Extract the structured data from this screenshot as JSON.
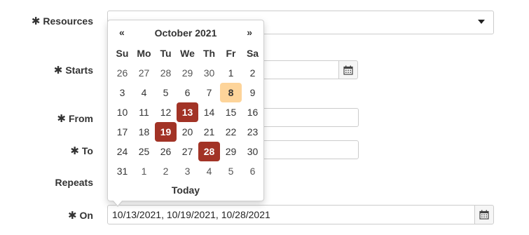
{
  "form": {
    "required_marker": "✱",
    "resources_label": "Resources",
    "starts_label": "Starts",
    "from_label": "From",
    "to_label": "To",
    "repeats_label": "Repeats",
    "on_label": "On",
    "on_value": "10/13/2021, 10/19/2021, 10/28/2021"
  },
  "datepicker": {
    "prev": "«",
    "next": "»",
    "month_title": "October 2021",
    "weekdays": [
      "Su",
      "Mo",
      "Tu",
      "We",
      "Th",
      "Fr",
      "Sa"
    ],
    "weeks": [
      [
        "26",
        "27",
        "28",
        "29",
        "30",
        "1",
        "2"
      ],
      [
        "3",
        "4",
        "5",
        "6",
        "7",
        "8",
        "9"
      ],
      [
        "10",
        "11",
        "12",
        "13",
        "14",
        "15",
        "16"
      ],
      [
        "17",
        "18",
        "19",
        "20",
        "21",
        "22",
        "23"
      ],
      [
        "24",
        "25",
        "26",
        "27",
        "28",
        "29",
        "30"
      ],
      [
        "31",
        "1",
        "2",
        "3",
        "4",
        "5",
        "6"
      ]
    ],
    "today_day": "8",
    "selected_days": [
      "13",
      "19",
      "28"
    ],
    "today_button": "Today"
  },
  "colors": {
    "selected": "#a23326",
    "today": "#fdd49a",
    "repeats_accent": "#f5a623"
  },
  "icons": {
    "calendar": "calendar-icon",
    "dropdown": "chevron-down-icon"
  }
}
